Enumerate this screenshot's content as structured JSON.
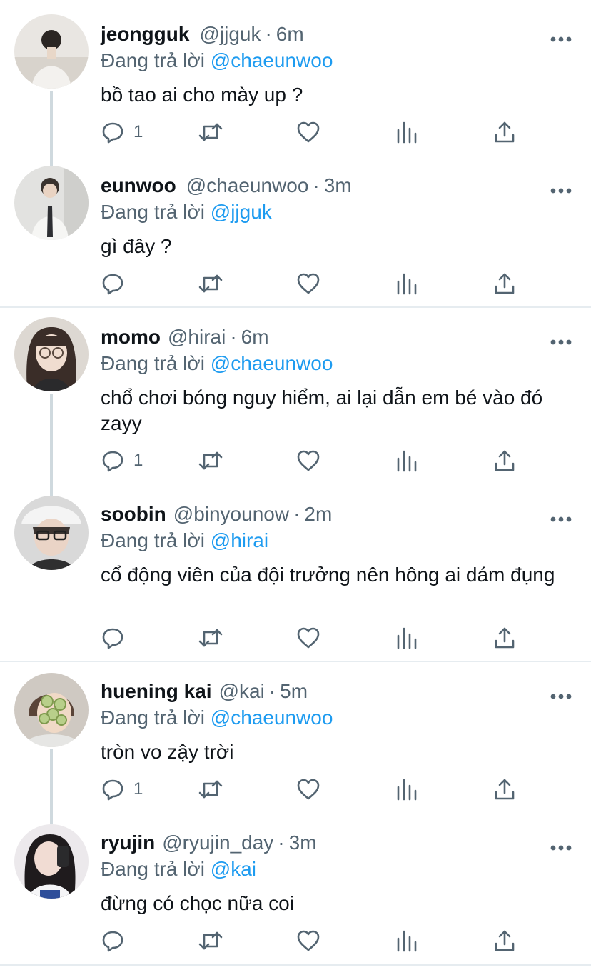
{
  "reply_prefix": "Đang trả lời",
  "tweets": [
    {
      "name": "jeongguk",
      "handle": "@jjguk",
      "time": "6m",
      "reply_to": "@chaeunwoo",
      "text": "bồ tao ai cho mày up ?",
      "reply_count": "1"
    },
    {
      "name": "eunwoo",
      "handle": "@chaeunwoo",
      "time": "3m",
      "reply_to": "@jjguk",
      "text": "gì đây ?",
      "reply_count": ""
    },
    {
      "name": "momo",
      "handle": "@hirai",
      "time": "6m",
      "reply_to": "@chaeunwoo",
      "text": "chổ chơi bóng nguy hiểm, ai lại dẫn em bé vào đó zayy",
      "reply_count": "1"
    },
    {
      "name": "soobin",
      "handle": "@binyounow",
      "time": "2m",
      "reply_to": "@hirai",
      "text": "cổ động viên của đội trưởng nên hông ai dám đụng",
      "reply_count": ""
    },
    {
      "name": "huening kai",
      "handle": "@kai",
      "time": "5m",
      "reply_to": "@chaeunwoo",
      "text": "tròn vo zậy trời",
      "reply_count": "1"
    },
    {
      "name": "ryujin",
      "handle": "@ryujin_day",
      "time": "3m",
      "reply_to": "@kai",
      "text": "đừng có chọc nữa coi",
      "reply_count": ""
    }
  ],
  "icons": {
    "reply": "comment-icon",
    "retweet": "retweet-icon",
    "like": "heart-icon",
    "stats": "analytics-icon",
    "share": "share-icon",
    "more": "more-icon"
  },
  "colors": {
    "mention": "#1d9bf0",
    "secondary_text": "#536471",
    "primary_text": "#0f1419",
    "thread_line": "#cfd9de",
    "separator": "#e6ecf0"
  }
}
